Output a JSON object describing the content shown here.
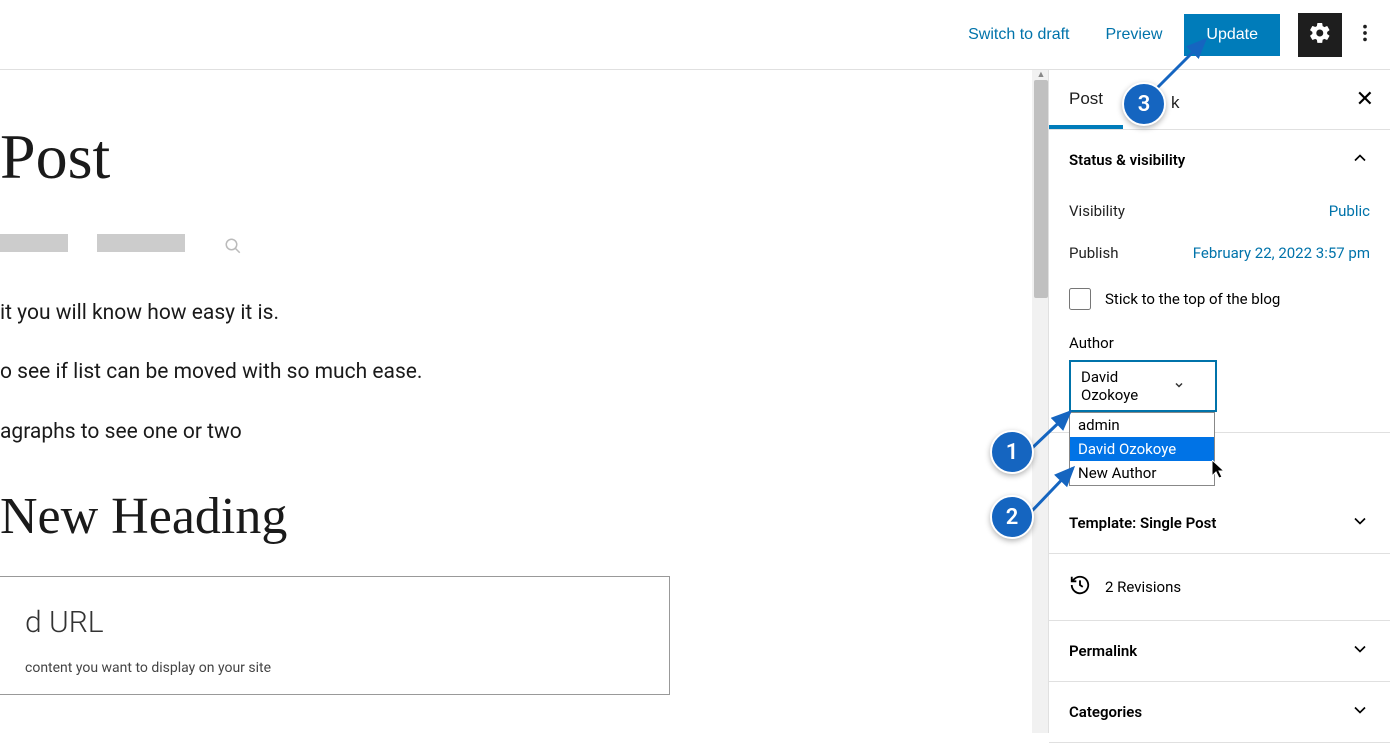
{
  "topbar": {
    "switch_to_draft": "Switch to draft",
    "preview": "Preview",
    "update": "Update"
  },
  "editor": {
    "post_title_partial": "Post",
    "para1": "it you will know how easy it is.",
    "para2": "o see if list can be moved with so much ease.",
    "para3": "agraphs to see one or two",
    "heading2": "New Heading",
    "embed_title": "d URL",
    "embed_desc": "content you want to display on your site"
  },
  "sidebar": {
    "tabs": {
      "post": "Post",
      "block_partial": "k"
    },
    "status_visibility": {
      "title": "Status & visibility",
      "visibility_label": "Visibility",
      "visibility_value": "Public",
      "publish_label": "Publish",
      "publish_value": "February 22, 2022 3:57 pm",
      "stick_label": "Stick to the top of the blog",
      "author_label": "Author",
      "author_selected": "David Ozokoye",
      "author_options": [
        "admin",
        "David Ozokoye",
        "New Author"
      ]
    },
    "template": {
      "title": "Template: Single Post"
    },
    "revisions": {
      "label": "2 Revisions"
    },
    "permalink": {
      "title": "Permalink"
    },
    "categories": {
      "title": "Categories"
    }
  },
  "annotations": {
    "badge1": "1",
    "badge2": "2",
    "badge3": "3"
  }
}
